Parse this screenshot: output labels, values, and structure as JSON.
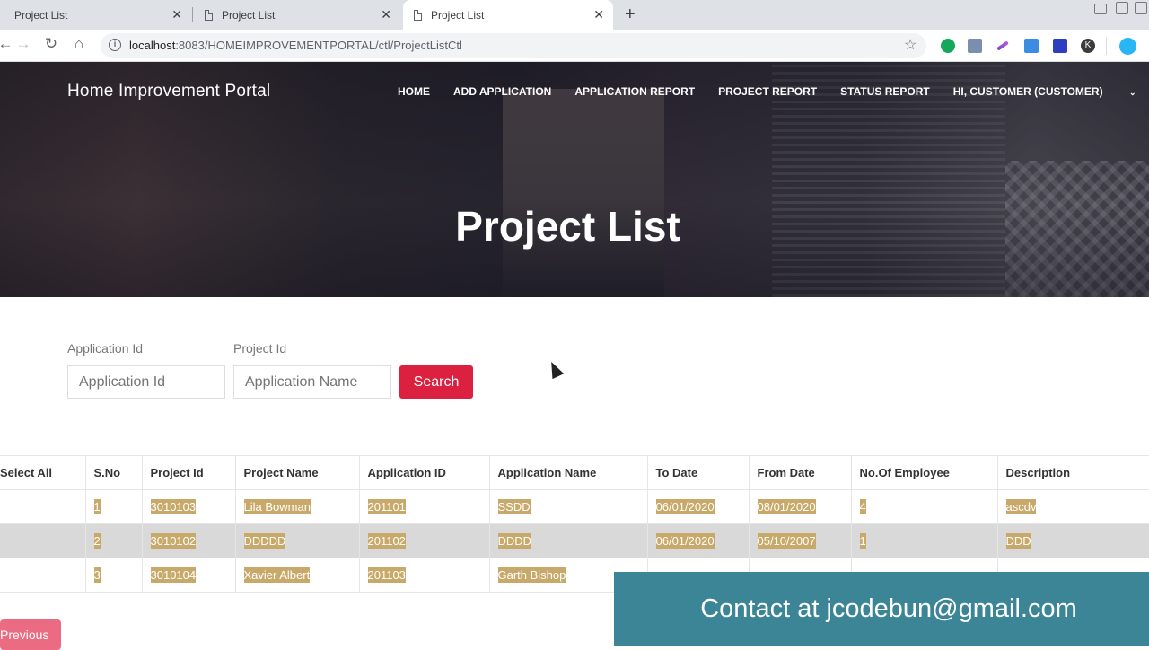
{
  "browser": {
    "tabs": [
      {
        "title": "Project List"
      },
      {
        "title": "Project List"
      },
      {
        "title": "Project List"
      }
    ],
    "new_tab": "+",
    "url_host": "localhost",
    "url_rest": ":8083/HOMEIMPROVEMENTPORTAL/ctl/ProjectListCtl",
    "profile_initial": "K"
  },
  "header": {
    "brand": "Home Improvement Portal",
    "menu": [
      "HOME",
      "ADD APPLICATION",
      "APPLICATION REPORT",
      "PROJECT REPORT",
      "STATUS REPORT",
      "HI, CUSTOMER (CUSTOMER)"
    ],
    "title": "Project List"
  },
  "search": {
    "app_label": "Application Id",
    "app_placeholder": "Application Id",
    "proj_label": "Project Id",
    "proj_placeholder": "Application Name",
    "button": "Search"
  },
  "table": {
    "columns": [
      "Select All",
      "S.No",
      "Project Id",
      "Project Name",
      "Application ID",
      "Application Name",
      "To Date",
      "From Date",
      "No.Of Employee",
      "Description"
    ],
    "rows": [
      [
        "",
        "1",
        "3010103",
        "Lila Bowman",
        "201101",
        "SSDD",
        "06/01/2020",
        "08/01/2020",
        "4",
        "ascdv"
      ],
      [
        "",
        "2",
        "3010102",
        "DDDDD",
        "201102",
        "DDDD",
        "06/01/2020",
        "05/10/2007",
        "1",
        "DDD"
      ],
      [
        "",
        "3",
        "3010104",
        "Xavier Albert",
        "201103",
        "Garth Bishop",
        "",
        "",
        "",
        ""
      ]
    ]
  },
  "overlay": {
    "contact": "Contact at jcodebun@gmail.com"
  },
  "pagination": {
    "previous": "Previous"
  }
}
